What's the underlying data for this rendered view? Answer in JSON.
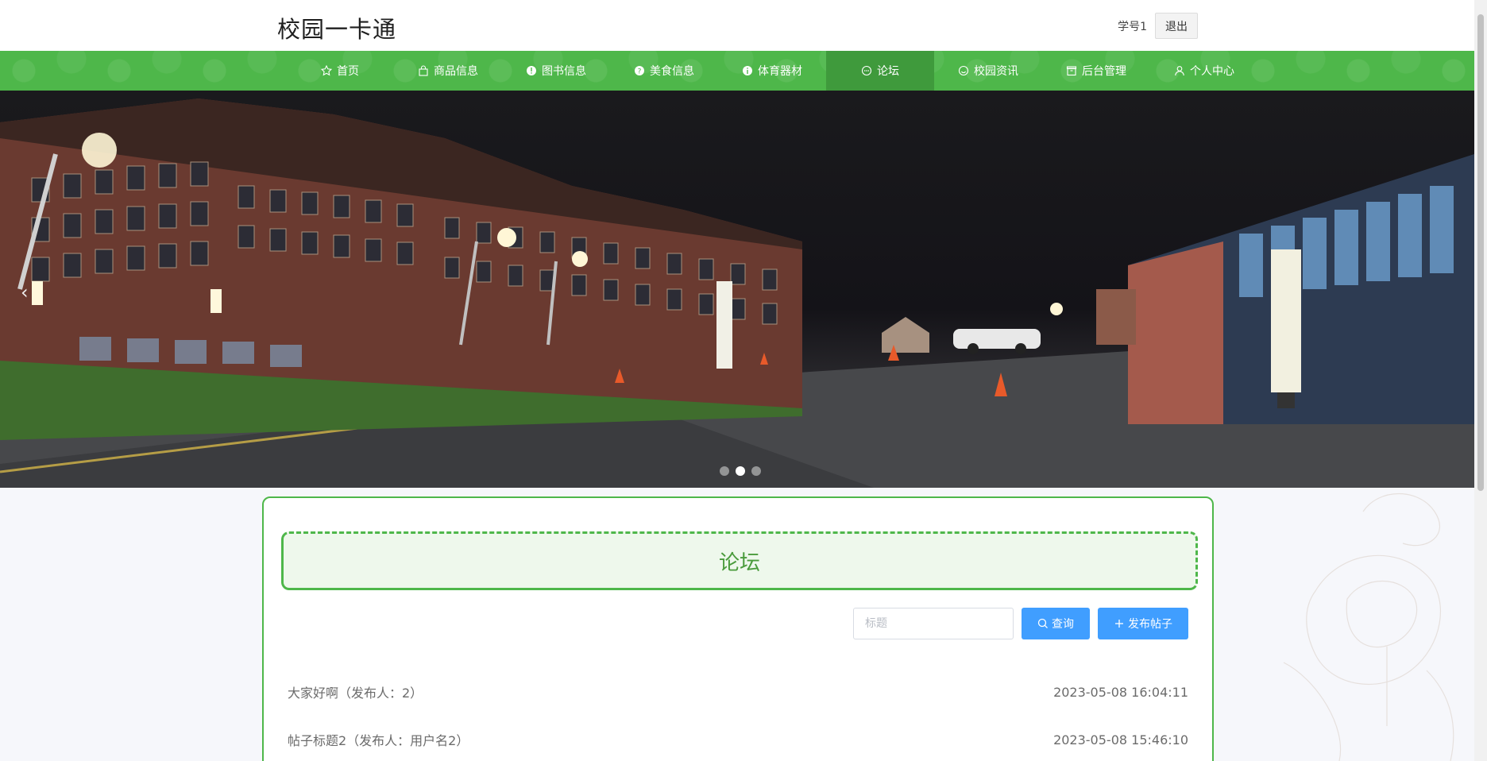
{
  "header": {
    "site_title": "校园一卡通",
    "user_label": "学号1",
    "logout_label": "退出"
  },
  "nav": {
    "items": [
      {
        "label": "首页",
        "icon": "star-icon"
      },
      {
        "label": "商品信息",
        "icon": "bag-icon"
      },
      {
        "label": "图书信息",
        "icon": "info-icon"
      },
      {
        "label": "美食信息",
        "icon": "help-icon"
      },
      {
        "label": "体育器材",
        "icon": "info-icon"
      },
      {
        "label": "论坛",
        "icon": "chat-icon"
      },
      {
        "label": "校园资讯",
        "icon": "smile-icon"
      },
      {
        "label": "后台管理",
        "icon": "box-icon"
      },
      {
        "label": "个人中心",
        "icon": "user-icon"
      }
    ],
    "active_index": 5
  },
  "banner": {
    "slides": 3,
    "active_slide": 1
  },
  "forum": {
    "title": "论坛",
    "search_placeholder": "标题",
    "search_button": "查询",
    "publish_button": "发布帖子",
    "posts": [
      {
        "title": "大家好啊（发布人：2）",
        "time": "2023-05-08 16:04:11"
      },
      {
        "title": "帖子标题2（发布人：用户名2）",
        "time": "2023-05-08 15:46:10"
      }
    ]
  },
  "colors": {
    "primary_green": "#4eb74a",
    "active_green": "#3f9a3c",
    "button_blue": "#409eff"
  }
}
